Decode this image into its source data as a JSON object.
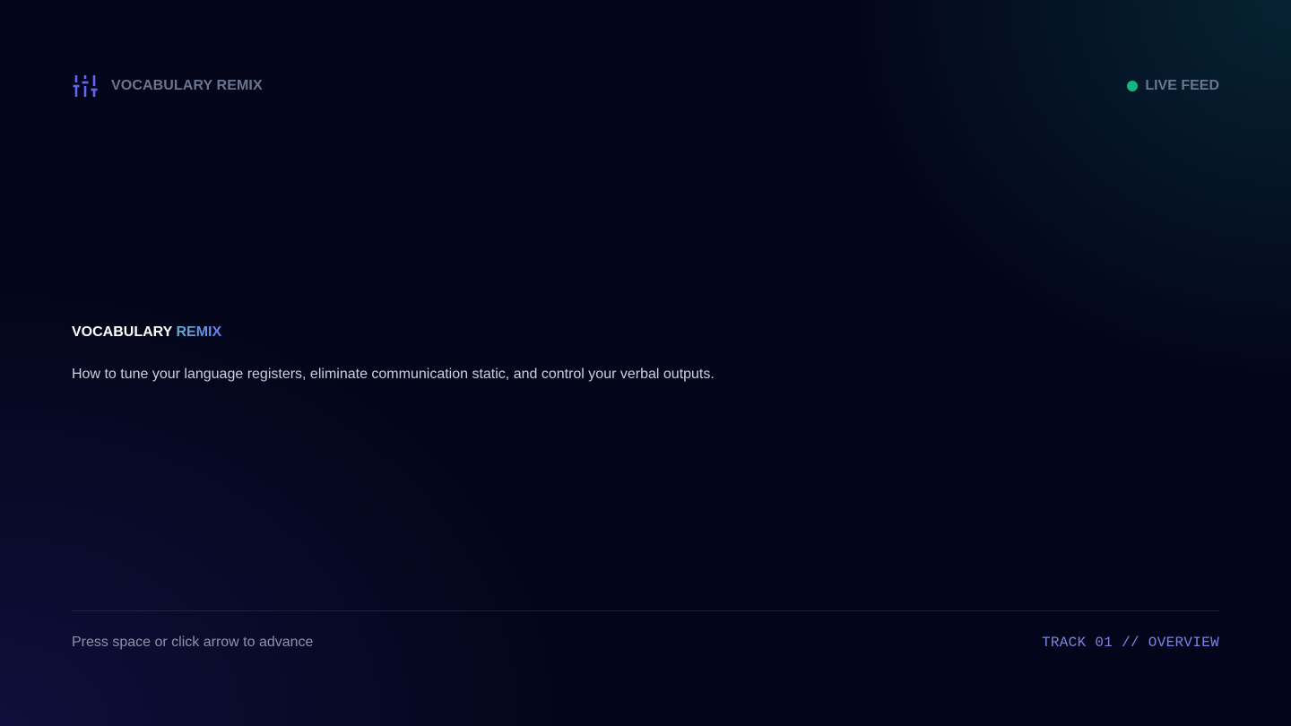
{
  "header": {
    "brand_icon": "sliders-icon",
    "brand_label": "VOCABULARY REMIX",
    "status_label": "LIVE FEED",
    "status_color": "#10b981"
  },
  "hero": {
    "title_part1": "VOCABULARY",
    "title_part2": "REMIX",
    "subtitle": "How to tune your language registers, eliminate communication static, and control your verbal outputs."
  },
  "footer": {
    "hint": "Press space or click arrow to advance",
    "track": "TRACK 01 // OVERVIEW"
  },
  "colors": {
    "accent": "#6366f1",
    "accent_gradient_start": "#5eb1d8",
    "accent_gradient_end": "#6a7ee6",
    "background": "#03061a"
  }
}
